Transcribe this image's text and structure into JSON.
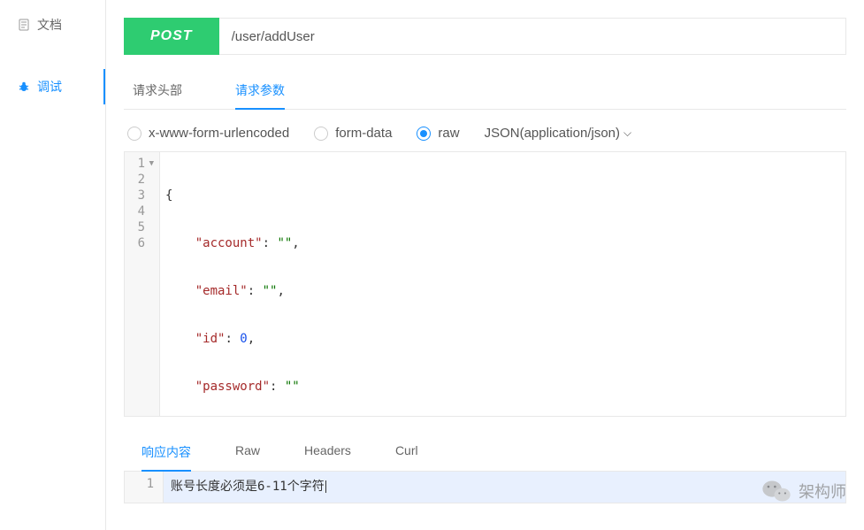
{
  "sidebar": {
    "items": [
      {
        "label": "文档",
        "icon": "document-icon"
      },
      {
        "label": "调试",
        "icon": "bug-icon"
      }
    ]
  },
  "request": {
    "method": "POST",
    "url": "/user/addUser"
  },
  "tabs": {
    "headers": "请求头部",
    "params": "请求参数"
  },
  "body_types": {
    "urlencoded": "x-www-form-urlencoded",
    "formdata": "form-data",
    "raw": "raw",
    "content_type": "JSON(application/json)"
  },
  "editor": {
    "lines": [
      "{",
      "    \"account\": \"\",",
      "    \"email\": \"\",",
      "    \"id\": 0,",
      "    \"password\": \"\"",
      "}"
    ],
    "gutter": [
      "1",
      "2",
      "3",
      "4",
      "5",
      "6"
    ]
  },
  "response_tabs": {
    "content": "响应内容",
    "raw": "Raw",
    "headers": "Headers",
    "curl": "Curl"
  },
  "response": {
    "gutter": "1",
    "text": "账号长度必须是6-11个字符"
  },
  "watermark": "架构师"
}
